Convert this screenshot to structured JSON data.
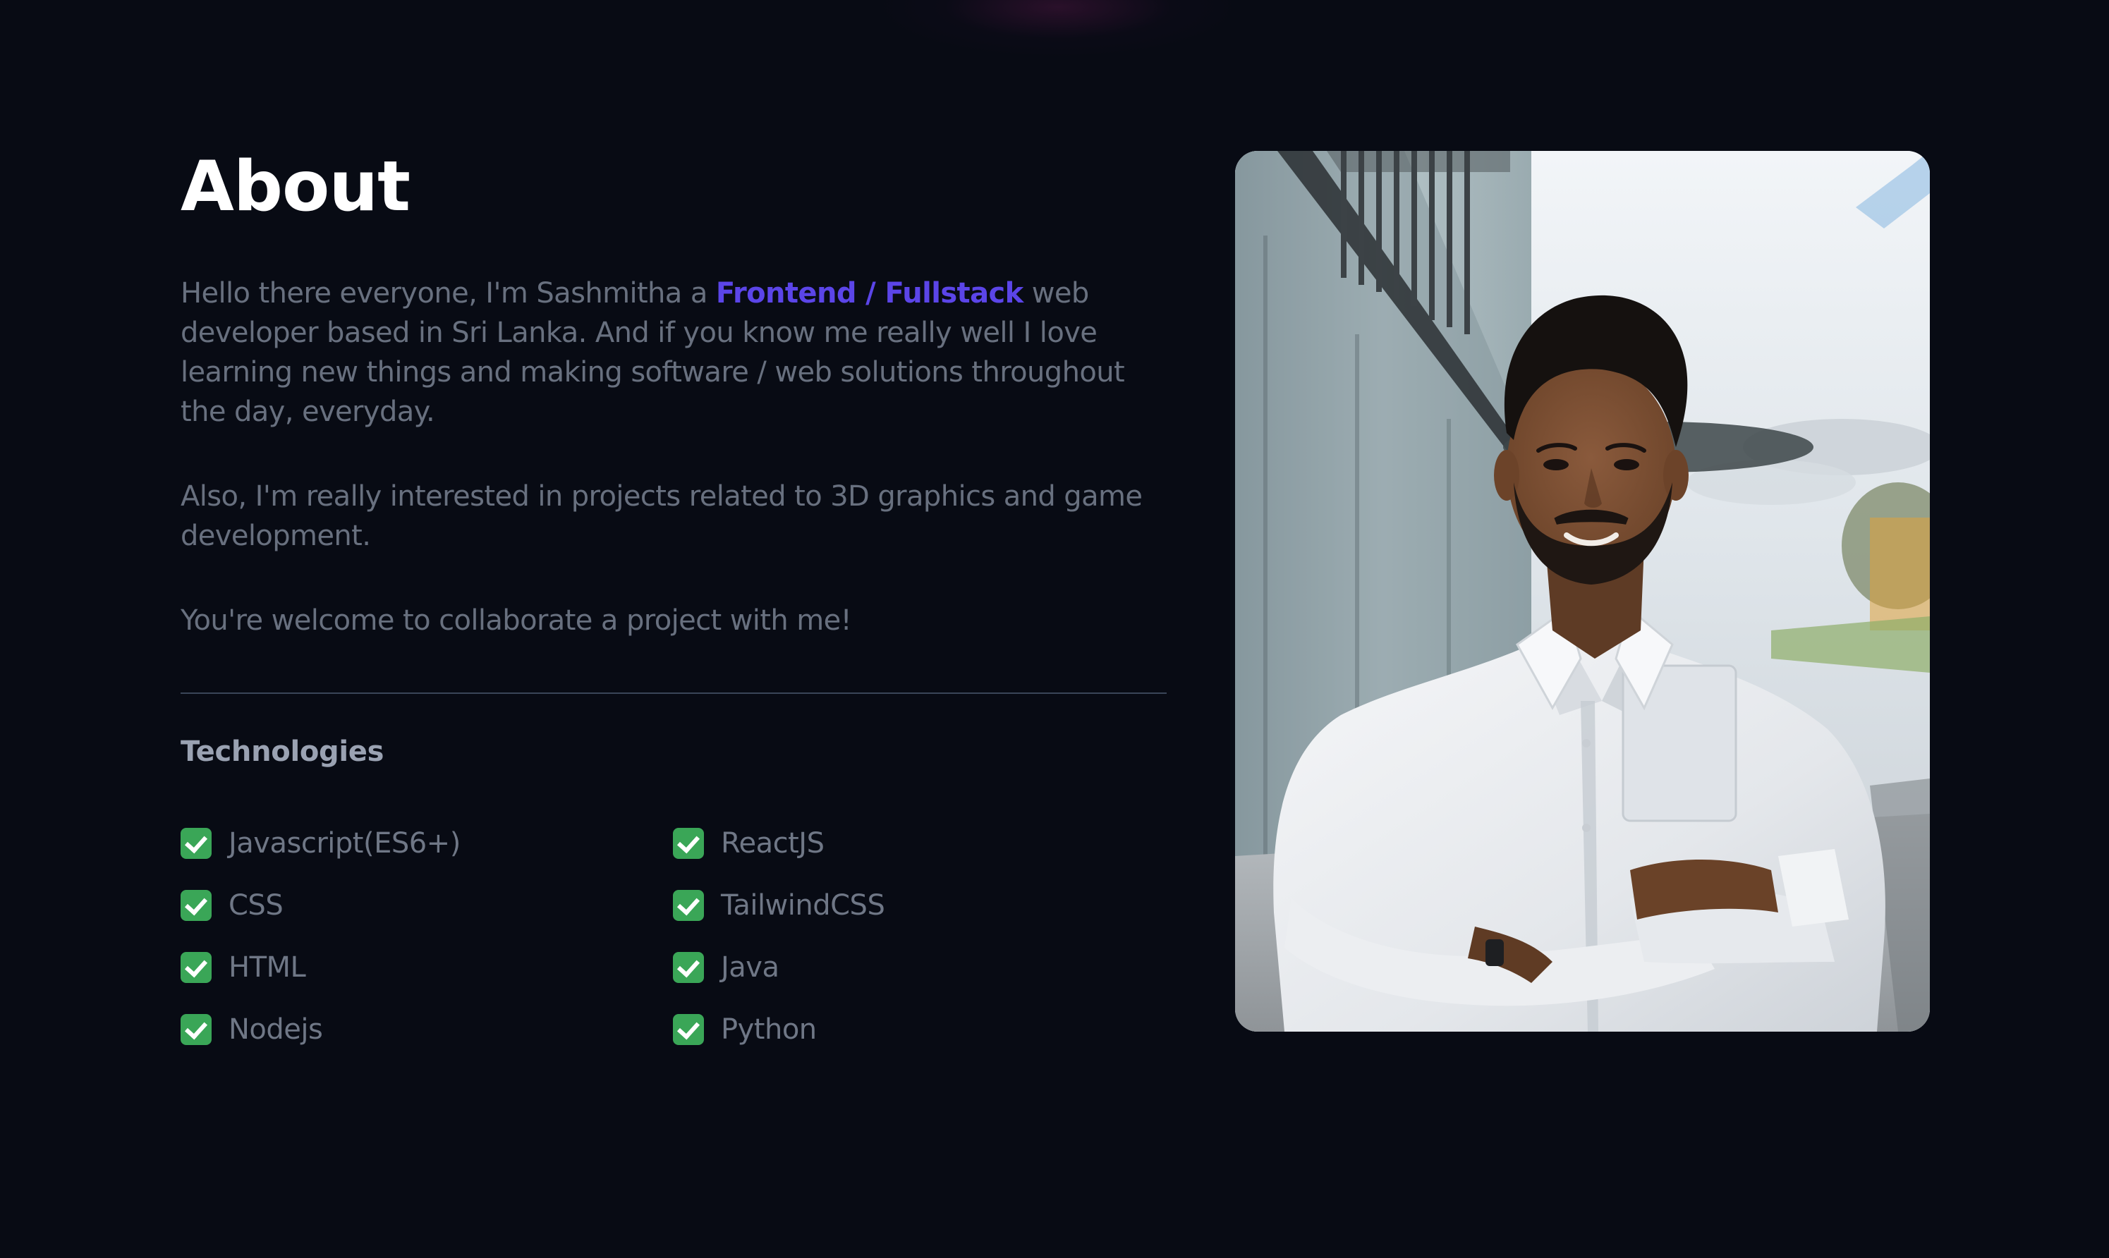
{
  "about": {
    "title": "About",
    "para1_start": "Hello there everyone, I'm Sashmitha a ",
    "para1_highlight": "Frontend / Fullstack",
    "para1_end": " web developer based in Sri Lanka. And if you know me really well I love learning new things and making software / web solutions throughout the day, everyday.",
    "para2": "Also, I'm really interested in projects related to 3D graphics and game development.",
    "para3": "You're welcome to collaborate a project with me!"
  },
  "technologies": {
    "title": "Technologies",
    "items": [
      {
        "label": "Javascript(ES6+)",
        "icon": "check-mark-icon"
      },
      {
        "label": "ReactJS",
        "icon": "check-mark-icon"
      },
      {
        "label": "CSS",
        "icon": "check-mark-icon"
      },
      {
        "label": "TailwindCSS",
        "icon": "check-mark-icon"
      },
      {
        "label": "HTML",
        "icon": "check-mark-icon"
      },
      {
        "label": "Java",
        "icon": "check-mark-icon"
      },
      {
        "label": "Nodejs",
        "icon": "check-mark-icon"
      },
      {
        "label": "Python",
        "icon": "check-mark-icon"
      }
    ]
  },
  "colors": {
    "background": "#080b14",
    "heading": "#ffffff",
    "body_text": "#68707f",
    "accent": "#5b45e8",
    "check": "#3aa657"
  }
}
